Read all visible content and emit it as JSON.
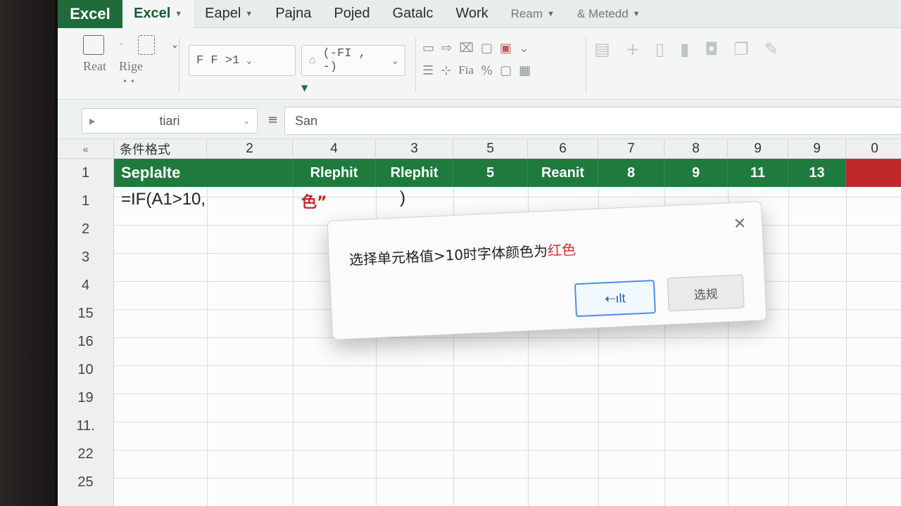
{
  "tabs": [
    {
      "label": "Excel",
      "kind": "brand"
    },
    {
      "label": "Excel",
      "kind": "active"
    },
    {
      "label": "Eapel",
      "kind": "normal"
    },
    {
      "label": "Pajna",
      "kind": "normal"
    },
    {
      "label": "Pojed",
      "kind": "normal"
    },
    {
      "label": "Gatalc",
      "kind": "normal"
    },
    {
      "label": "Work",
      "kind": "normal"
    },
    {
      "label": "Ream",
      "kind": "faded"
    },
    {
      "label": "& Metedd",
      "kind": "faded"
    }
  ],
  "ribbon": {
    "label_1": "Reat",
    "label_2": "Rige",
    "box_1": "F F >1",
    "box_2": "(-FI , -)",
    "label_3": "Fia"
  },
  "formula_bar": {
    "name_box": "tiari",
    "fx_symbol": "≡",
    "formula": "San"
  },
  "grid": {
    "corner": "«",
    "col_headers": [
      "条件格式",
      "2",
      "4",
      "3",
      "5",
      "6",
      "7",
      "8",
      "9",
      "9",
      "0"
    ],
    "row_numbers": [
      "1",
      "1",
      "2",
      "3",
      "4",
      "15",
      "16",
      "10",
      "19",
      "11.",
      "22",
      "25"
    ],
    "header_cells": [
      "Seplalte",
      "Rlephit",
      "Rlephit",
      "5",
      "Reanit",
      "8",
      "9",
      "11",
      "13",
      ""
    ],
    "formula_cell": "=IF(A1>10,",
    "red_cell": "色”",
    "paren_cell": ")"
  },
  "dialog": {
    "message_prefix": "选择单元格值>10时字体颜色为",
    "message_highlight": "红色",
    "close": "✕",
    "ok_label": "⇠ılt",
    "cancel_label": "选规"
  },
  "colors": {
    "brand_green": "#1e7a3d",
    "accent_red": "#c0282c",
    "ok_blue": "#4a90e2"
  }
}
